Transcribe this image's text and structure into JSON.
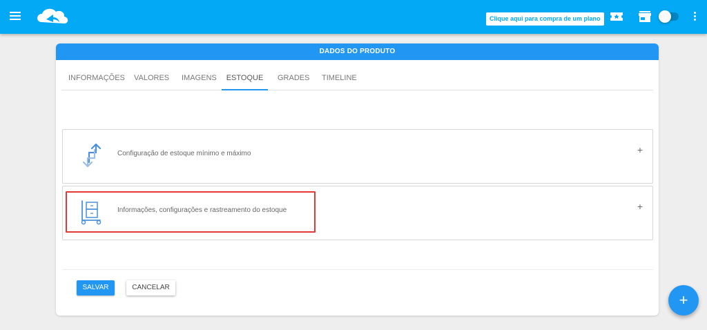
{
  "topbar": {
    "plan_button_label": "Clique aqui para compra de um plano",
    "icons": [
      "menu-icon",
      "app-logo",
      "ticket-icon",
      "store-icon",
      "toggle",
      "more-vert-icon"
    ]
  },
  "card": {
    "header_title": "DADOS DO PRODUTO",
    "tabs": [
      {
        "label": "INFORMAÇÕES",
        "active": false
      },
      {
        "label": "VALORES",
        "active": false
      },
      {
        "label": "IMAGENS",
        "active": false
      },
      {
        "label": "ESTOQUE",
        "active": true
      },
      {
        "label": "GRADES",
        "active": false
      },
      {
        "label": "TIMELINE",
        "active": false
      }
    ],
    "panels": [
      {
        "label": "Configuração de estoque mínimo e máximo",
        "icon": "arrows-up-down-icon",
        "expand_symbol": "+"
      },
      {
        "label": "Informações, configurações e rastreamento do estoque",
        "icon": "hand-truck-icon",
        "expand_symbol": "+"
      }
    ],
    "save_label": "SALVAR",
    "cancel_label": "CANCELAR"
  },
  "fab_symbol": "+",
  "colors": {
    "topbar": "#03a9f4",
    "header": "#2196f3",
    "primary_button": "#2196f3",
    "highlight_box": "#e53935"
  }
}
